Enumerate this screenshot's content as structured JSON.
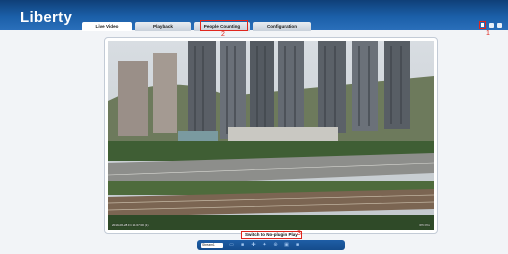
{
  "header": {
    "logo": "Liberty"
  },
  "tabs": [
    {
      "label": "Live Video",
      "active": true
    },
    {
      "label": "Playback",
      "active": false
    },
    {
      "label": "People Counting",
      "active": false
    },
    {
      "label": "Configuration",
      "active": false
    }
  ],
  "annotations": {
    "one": "1",
    "two": "2",
    "three": "3"
  },
  "video": {
    "timestamp": "2019-06-28 Fri 11:07:00 (1)",
    "camera_label": "IPC Pro"
  },
  "switch_plugin": {
    "label": "Switch to No-plugin Play"
  },
  "toolbar": {
    "stream_value": "Stream1",
    "icons": [
      "layout-icon",
      "snapshot-icon",
      "record-icon",
      "ptz-icon",
      "zoom-icon",
      "audio-icon",
      "fullscreen-icon"
    ]
  },
  "colors": {
    "header": "#1b5fa8",
    "highlight": "#e0261d",
    "toolbar": "#1f5ea6"
  }
}
